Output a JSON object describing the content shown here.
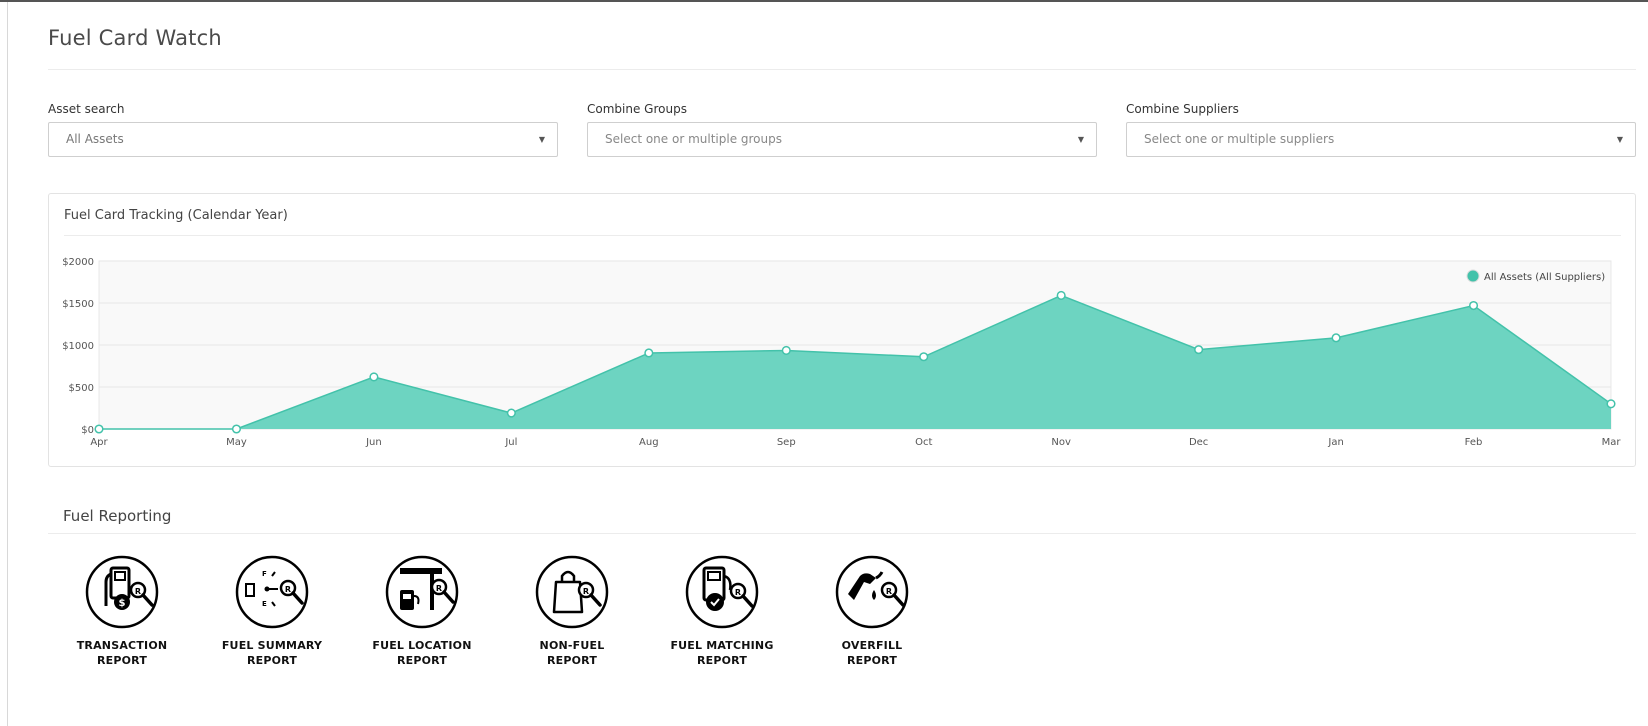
{
  "page": {
    "title": "Fuel Card Watch"
  },
  "filters": {
    "asset": {
      "label": "Asset search",
      "value": "All Assets"
    },
    "groups": {
      "label": "Combine Groups",
      "placeholder": "Select one or multiple groups"
    },
    "suppliers": {
      "label": "Combine Suppliers",
      "placeholder": "Select one or multiple suppliers"
    }
  },
  "chart_panel": {
    "title": "Fuel Card Tracking (Calendar Year)"
  },
  "chart_data": {
    "type": "area",
    "x": [
      "Apr",
      "May",
      "Jun",
      "Jul",
      "Aug",
      "Sep",
      "Oct",
      "Nov",
      "Dec",
      "Jan",
      "Feb",
      "Mar"
    ],
    "series": [
      {
        "name": "All Assets (All Suppliers)",
        "values": [
          0,
          0,
          620,
          190,
          905,
          935,
          860,
          1590,
          945,
          1085,
          1470,
          300
        ]
      }
    ],
    "yticks": [
      "$0",
      "$500",
      "$1000",
      "$1500",
      "$2000"
    ],
    "ylim": [
      0,
      2000
    ],
    "grid": true,
    "legend_position": "top-right",
    "color": "#6dd4c1",
    "stroke": "#43c2aa"
  },
  "reporting": {
    "title": "Fuel Reporting",
    "reports": [
      {
        "icon": "fuel-pump-dollar-icon",
        "line1": "TRANSACTION",
        "line2": "REPORT"
      },
      {
        "icon": "fuel-gauge-icon",
        "line1": "FUEL SUMMARY",
        "line2": "REPORT"
      },
      {
        "icon": "fuel-station-icon",
        "line1": "FUEL LOCATION",
        "line2": "REPORT"
      },
      {
        "icon": "shopping-bag-icon",
        "line1": "NON-FUEL",
        "line2": "REPORT"
      },
      {
        "icon": "fuel-pump-check-icon",
        "line1": "FUEL MATCHING",
        "line2": "REPORT"
      },
      {
        "icon": "fuel-nozzle-drop-icon",
        "line1": "OVERFILL",
        "line2": "REPORT"
      }
    ]
  }
}
